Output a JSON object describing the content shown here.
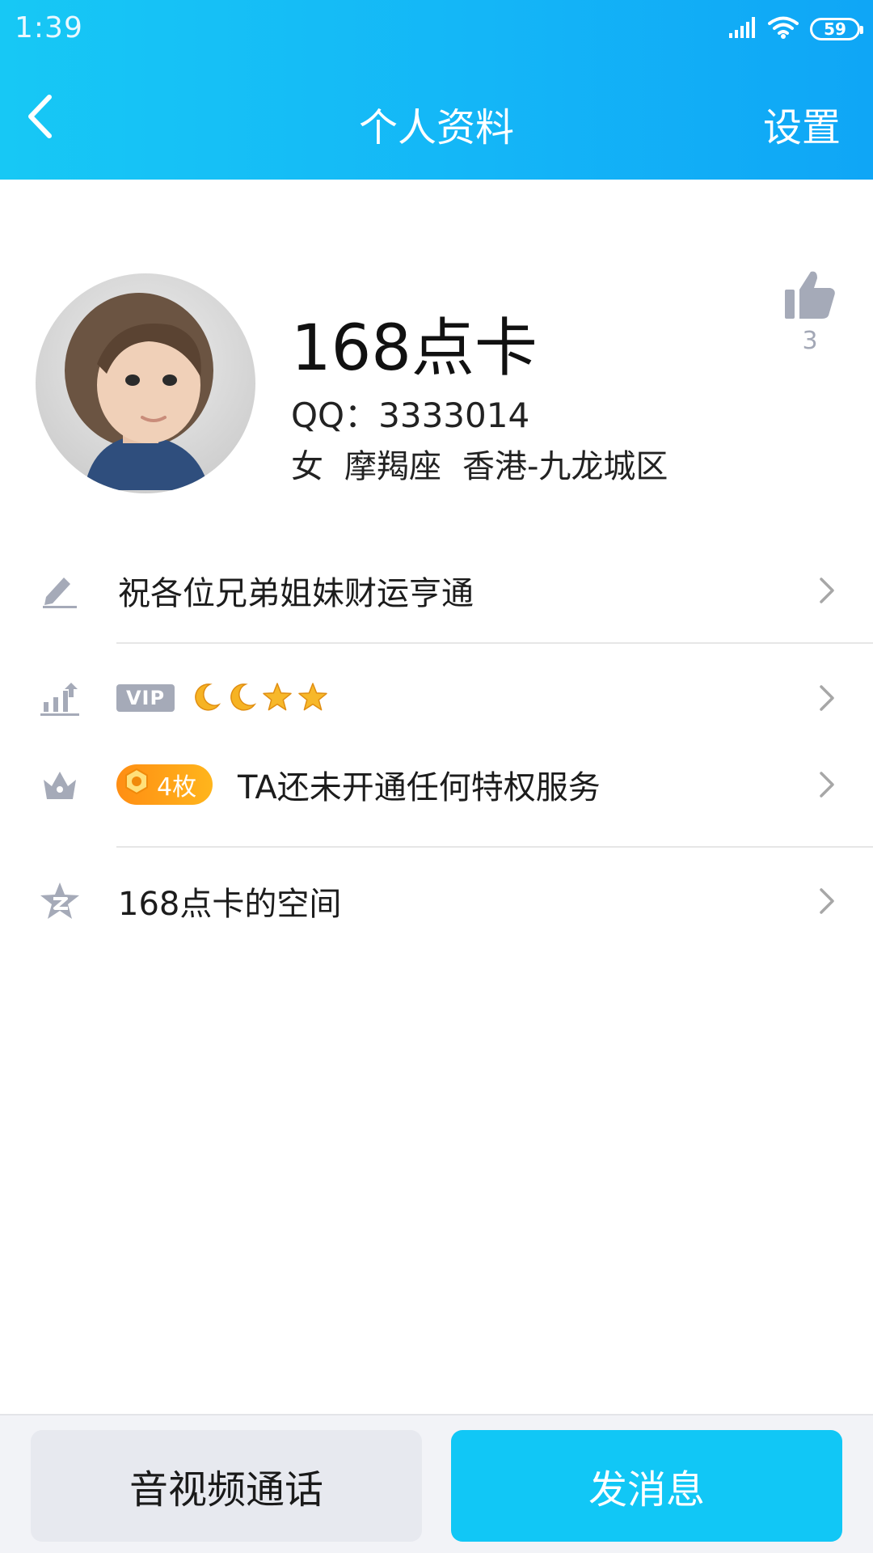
{
  "status_bar": {
    "time": "1:39",
    "battery": "59",
    "icons": [
      "signal-icon",
      "wifi-icon",
      "battery-icon"
    ]
  },
  "nav": {
    "back_icon": "chevron-left-icon",
    "title": "个人资料",
    "settings_label": "设置"
  },
  "profile": {
    "name": "168点卡",
    "qq_label": "QQ：",
    "qq_number": "3333014",
    "gender": "女",
    "zodiac": "摩羯座",
    "location": "香港-九龙城区",
    "like_count": "3",
    "like_icon": "thumbs-up-icon"
  },
  "rows": {
    "signature": {
      "icon": "pencil-icon",
      "text": "祝各位兄弟姐妹财运亨通"
    },
    "level": {
      "icon": "level-chart-icon",
      "badge": "VIP",
      "level_icons": [
        "moon-icon",
        "moon-icon",
        "star-icon",
        "star-icon"
      ]
    },
    "privilege": {
      "icon": "crown-icon",
      "medal_count": "4枚",
      "text": "TA还未开通任何特权服务"
    },
    "qzone": {
      "icon": "qzone-star-icon",
      "text": "168点卡的空间"
    }
  },
  "actions": {
    "call_label": "音视频通话",
    "message_label": "发消息"
  },
  "colors": {
    "header_blue": "#14b6f7",
    "primary_button": "#11c7f6",
    "secondary_button": "#e7e9ef",
    "icon_gray": "#a5aab8",
    "medal_orange": "#ff9a16"
  }
}
